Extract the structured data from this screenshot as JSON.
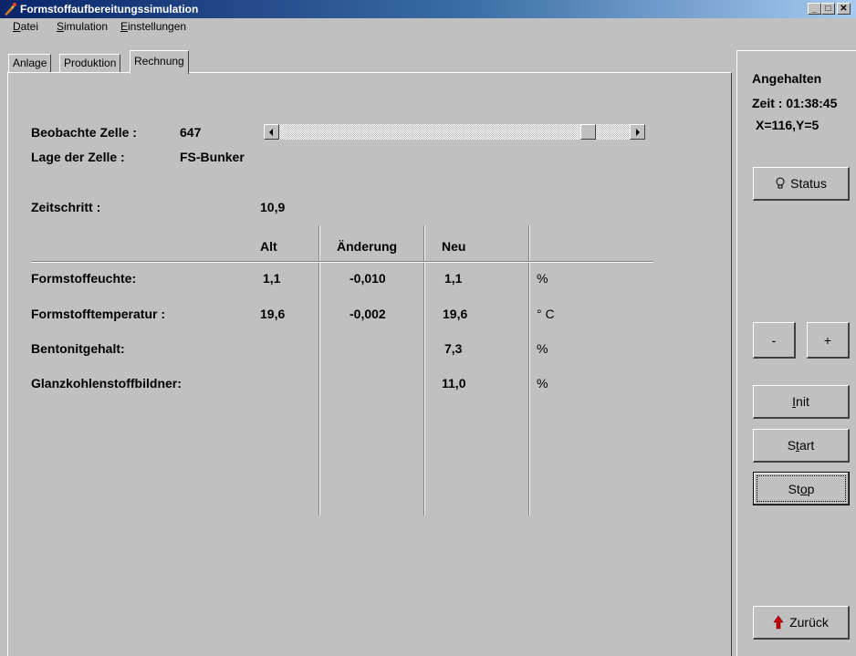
{
  "window": {
    "title": "Formstoffaufbereitungssimulation",
    "buttons": {
      "minimize": "_",
      "maximize": "□",
      "close": "✕"
    }
  },
  "menu": {
    "items": [
      {
        "label": "Datei",
        "accel": "D",
        "rest": "atei"
      },
      {
        "label": "Simulation",
        "accel": "S",
        "rest": "imulation"
      },
      {
        "label": "Einstellungen",
        "accel": "E",
        "rest": "instellungen"
      }
    ]
  },
  "tabs": [
    {
      "label": "Anlage",
      "active": false
    },
    {
      "label": "Produktion",
      "active": false
    },
    {
      "label": "Rechnung",
      "active": true
    }
  ],
  "cell": {
    "observe_label": "Beobachte Zelle :",
    "observe_value": "647",
    "position_label": "Lage der Zelle :",
    "position_value": "FS-Bunker",
    "scroll_fraction": 0.9
  },
  "timestep": {
    "label": "Zeitschritt :",
    "value": "10,9"
  },
  "table": {
    "headers": [
      "Alt",
      "Änderung",
      "Neu"
    ],
    "rows": [
      {
        "name": "Formstoffeuchte:",
        "alt": "1,1",
        "change": "-0,010",
        "neu": "1,1",
        "unit": "%"
      },
      {
        "name": "Formstofftemperatur :",
        "alt": "19,6",
        "change": "-0,002",
        "neu": "19,6",
        "unit": "° C"
      },
      {
        "name": "Bentonitgehalt:",
        "alt": "",
        "change": "",
        "neu": "7,3",
        "unit": "%"
      },
      {
        "name": "Glanzkohlenstoffbildner:",
        "alt": "",
        "change": "",
        "neu": "11,0",
        "unit": "%"
      }
    ]
  },
  "status_panel": {
    "state": "Angehalten",
    "time": "Zeit : 01:38:45",
    "coords": "X=116,Y=5",
    "status_button": "Status",
    "minus_button": "-",
    "plus_button": "+",
    "init_button": {
      "accel": "I",
      "rest": "nit"
    },
    "start_button": {
      "pre": "S",
      "accel": "t",
      "rest": "art"
    },
    "stop_button": {
      "pre": "St",
      "accel": "o",
      "rest": "p"
    },
    "back_button": "Zurück"
  },
  "colors": {
    "titlebar_start": "#0a246a",
    "titlebar_end": "#a6caf0",
    "face": "#c0c0c0",
    "back_arrow": "#cc0000"
  }
}
